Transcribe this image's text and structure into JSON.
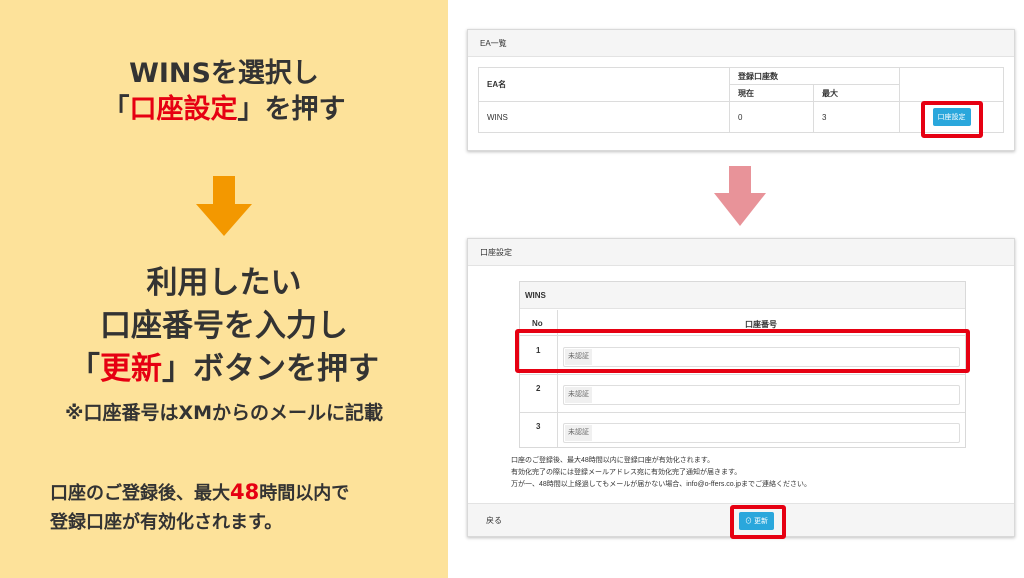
{
  "left": {
    "step1_line1": "WINSを選択し",
    "step1_open": "「",
    "step1_highlight": "口座設定",
    "step1_close": "」を押す",
    "step2_line1": "利用したい",
    "step2_line2": "口座番号を入力し",
    "step2_open": "「",
    "step2_highlight": "更新",
    "step2_close": "」ボタンを押す",
    "note": "※口座番号はXMからのメールに記載",
    "foot_a": "口座のご登録後、最大",
    "foot_num": "48",
    "foot_b": "時間以内で",
    "foot_line2": "登録口座が有効化されます。"
  },
  "ea_panel": {
    "title": "EA一覧",
    "col_name": "EA名",
    "col_count": "登録口座数",
    "col_current": "現在",
    "col_max": "最大",
    "rows": [
      {
        "name": "WINS",
        "current": "0",
        "max": "3",
        "button": "口座設定"
      }
    ]
  },
  "account_panel": {
    "title": "口座設定",
    "ea_name": "WINS",
    "col_no": "No",
    "col_account": "口座番号",
    "rows": [
      {
        "no": "1",
        "status": "未認証"
      },
      {
        "no": "2",
        "status": "未認証"
      },
      {
        "no": "3",
        "status": "未認証"
      }
    ],
    "notes": [
      "口座のご登録後、最大48時間以内に登録口座が有効化されます。",
      "有効化完了の際には登録メールアドレス宛に有効化完了通知が届きます。",
      "万が一、48時間以上経過してもメールが届かない場合、info@o-ffers.co.jpまでご連絡ください。"
    ],
    "back": "戻る",
    "update": "更新"
  },
  "colors": {
    "left_bg": "#fde29a",
    "highlight_red": "#e60012",
    "orange_arrow": "#f39800",
    "pink_arrow": "#e89399",
    "button_blue": "#2aa7dc"
  }
}
